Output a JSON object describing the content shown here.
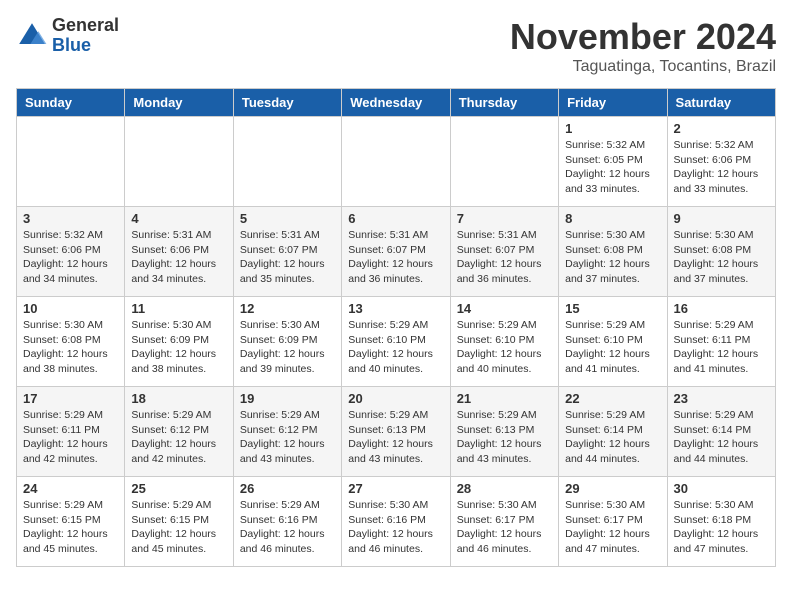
{
  "logo": {
    "general": "General",
    "blue": "Blue"
  },
  "header": {
    "month": "November 2024",
    "location": "Taguatinga, Tocantins, Brazil"
  },
  "weekdays": [
    "Sunday",
    "Monday",
    "Tuesday",
    "Wednesday",
    "Thursday",
    "Friday",
    "Saturday"
  ],
  "weeks": [
    [
      {
        "day": "",
        "info": ""
      },
      {
        "day": "",
        "info": ""
      },
      {
        "day": "",
        "info": ""
      },
      {
        "day": "",
        "info": ""
      },
      {
        "day": "",
        "info": ""
      },
      {
        "day": "1",
        "info": "Sunrise: 5:32 AM\nSunset: 6:05 PM\nDaylight: 12 hours\nand 33 minutes."
      },
      {
        "day": "2",
        "info": "Sunrise: 5:32 AM\nSunset: 6:06 PM\nDaylight: 12 hours\nand 33 minutes."
      }
    ],
    [
      {
        "day": "3",
        "info": "Sunrise: 5:32 AM\nSunset: 6:06 PM\nDaylight: 12 hours\nand 34 minutes."
      },
      {
        "day": "4",
        "info": "Sunrise: 5:31 AM\nSunset: 6:06 PM\nDaylight: 12 hours\nand 34 minutes."
      },
      {
        "day": "5",
        "info": "Sunrise: 5:31 AM\nSunset: 6:07 PM\nDaylight: 12 hours\nand 35 minutes."
      },
      {
        "day": "6",
        "info": "Sunrise: 5:31 AM\nSunset: 6:07 PM\nDaylight: 12 hours\nand 36 minutes."
      },
      {
        "day": "7",
        "info": "Sunrise: 5:31 AM\nSunset: 6:07 PM\nDaylight: 12 hours\nand 36 minutes."
      },
      {
        "day": "8",
        "info": "Sunrise: 5:30 AM\nSunset: 6:08 PM\nDaylight: 12 hours\nand 37 minutes."
      },
      {
        "day": "9",
        "info": "Sunrise: 5:30 AM\nSunset: 6:08 PM\nDaylight: 12 hours\nand 37 minutes."
      }
    ],
    [
      {
        "day": "10",
        "info": "Sunrise: 5:30 AM\nSunset: 6:08 PM\nDaylight: 12 hours\nand 38 minutes."
      },
      {
        "day": "11",
        "info": "Sunrise: 5:30 AM\nSunset: 6:09 PM\nDaylight: 12 hours\nand 38 minutes."
      },
      {
        "day": "12",
        "info": "Sunrise: 5:30 AM\nSunset: 6:09 PM\nDaylight: 12 hours\nand 39 minutes."
      },
      {
        "day": "13",
        "info": "Sunrise: 5:29 AM\nSunset: 6:10 PM\nDaylight: 12 hours\nand 40 minutes."
      },
      {
        "day": "14",
        "info": "Sunrise: 5:29 AM\nSunset: 6:10 PM\nDaylight: 12 hours\nand 40 minutes."
      },
      {
        "day": "15",
        "info": "Sunrise: 5:29 AM\nSunset: 6:10 PM\nDaylight: 12 hours\nand 41 minutes."
      },
      {
        "day": "16",
        "info": "Sunrise: 5:29 AM\nSunset: 6:11 PM\nDaylight: 12 hours\nand 41 minutes."
      }
    ],
    [
      {
        "day": "17",
        "info": "Sunrise: 5:29 AM\nSunset: 6:11 PM\nDaylight: 12 hours\nand 42 minutes."
      },
      {
        "day": "18",
        "info": "Sunrise: 5:29 AM\nSunset: 6:12 PM\nDaylight: 12 hours\nand 42 minutes."
      },
      {
        "day": "19",
        "info": "Sunrise: 5:29 AM\nSunset: 6:12 PM\nDaylight: 12 hours\nand 43 minutes."
      },
      {
        "day": "20",
        "info": "Sunrise: 5:29 AM\nSunset: 6:13 PM\nDaylight: 12 hours\nand 43 minutes."
      },
      {
        "day": "21",
        "info": "Sunrise: 5:29 AM\nSunset: 6:13 PM\nDaylight: 12 hours\nand 43 minutes."
      },
      {
        "day": "22",
        "info": "Sunrise: 5:29 AM\nSunset: 6:14 PM\nDaylight: 12 hours\nand 44 minutes."
      },
      {
        "day": "23",
        "info": "Sunrise: 5:29 AM\nSunset: 6:14 PM\nDaylight: 12 hours\nand 44 minutes."
      }
    ],
    [
      {
        "day": "24",
        "info": "Sunrise: 5:29 AM\nSunset: 6:15 PM\nDaylight: 12 hours\nand 45 minutes."
      },
      {
        "day": "25",
        "info": "Sunrise: 5:29 AM\nSunset: 6:15 PM\nDaylight: 12 hours\nand 45 minutes."
      },
      {
        "day": "26",
        "info": "Sunrise: 5:29 AM\nSunset: 6:16 PM\nDaylight: 12 hours\nand 46 minutes."
      },
      {
        "day": "27",
        "info": "Sunrise: 5:30 AM\nSunset: 6:16 PM\nDaylight: 12 hours\nand 46 minutes."
      },
      {
        "day": "28",
        "info": "Sunrise: 5:30 AM\nSunset: 6:17 PM\nDaylight: 12 hours\nand 46 minutes."
      },
      {
        "day": "29",
        "info": "Sunrise: 5:30 AM\nSunset: 6:17 PM\nDaylight: 12 hours\nand 47 minutes."
      },
      {
        "day": "30",
        "info": "Sunrise: 5:30 AM\nSunset: 6:18 PM\nDaylight: 12 hours\nand 47 minutes."
      }
    ]
  ]
}
